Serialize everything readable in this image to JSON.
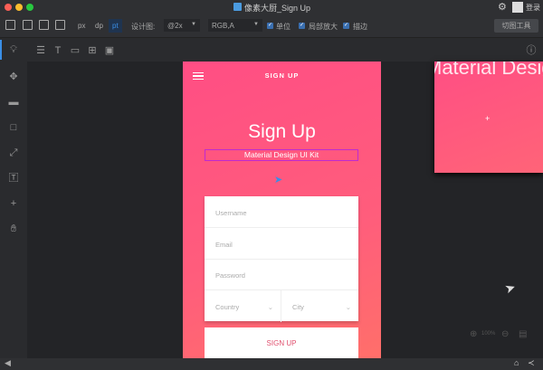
{
  "window": {
    "title": "像素大厨_Sign Up",
    "login": "登录"
  },
  "toolbar": {
    "units": [
      "px",
      "dp",
      "pt"
    ],
    "selected_unit": "pt",
    "design_label": "设计图:",
    "scale": "@2x",
    "color_format": "RGB,A",
    "checkboxes": [
      {
        "label": "单位",
        "checked": true
      },
      {
        "label": "局部放大",
        "checked": true
      },
      {
        "label": "描边",
        "checked": true
      }
    ],
    "slice_tool": "切图工具"
  },
  "phone": {
    "header": "SIGN UP",
    "title": "Sign Up",
    "subtitle": "Material Design UI Kit",
    "fields": [
      "Username",
      "Email",
      "Password"
    ],
    "country": "Country",
    "city": "City",
    "button": "SIGN UP"
  },
  "artboard2": {
    "text": "Material Design"
  },
  "zoom": {
    "level": "100%"
  },
  "colors": {
    "accent": "#ff5080",
    "selection": "#c02ad0"
  }
}
